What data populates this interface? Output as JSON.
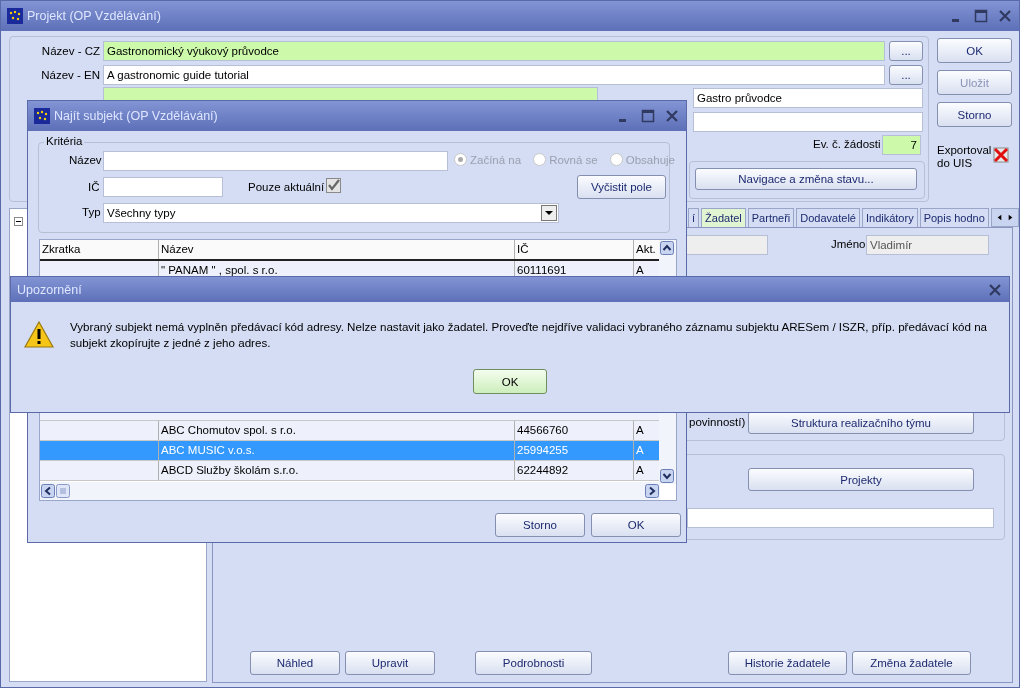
{
  "main_window": {
    "title": "Projekt  (OP Vzdělávání)",
    "name_fields": [
      {
        "label": "Název - CZ",
        "value": "Gastronomický výukový průvodce",
        "required": true,
        "button": "..."
      },
      {
        "label": "Název - EN",
        "value": "A gastronomic guide tutorial",
        "required": false,
        "button": "..."
      }
    ],
    "reg_number": {
      "required": true
    },
    "short_name_cz": {
      "value": "Gastro průvodce"
    },
    "application_number": {
      "label": "Ev. č. žádosti",
      "value": "7",
      "required": true
    },
    "navigation_button": "Navigace a změna stavu...",
    "side_buttons": [
      {
        "label": "OK",
        "disabled": false
      },
      {
        "label": "Uložit",
        "disabled": true
      },
      {
        "label": "Storno",
        "disabled": false
      }
    ],
    "exported": {
      "label": "Exportoval do UIS",
      "checked": false
    },
    "tabs": [
      {
        "label": "í",
        "selected": false
      },
      {
        "label": "Žadatel",
        "selected": true
      },
      {
        "label": "Partneři",
        "selected": false
      },
      {
        "label": "Dodavatelé",
        "selected": false
      },
      {
        "label": "Indikátory",
        "selected": false
      },
      {
        "label": "Popis hodno",
        "selected": false
      }
    ],
    "applicant": {
      "name_label": "Jméno",
      "name_value": "Vladimír",
      "obligations_text": "povinností)",
      "team_button": "Struktura realizačního týmu",
      "projects_button": "Projekty"
    },
    "bottom_buttons": [
      "Náhled",
      "Upravit",
      "Podrobnosti",
      "Historie žadatele",
      "Změna žadatele"
    ]
  },
  "find_dialog": {
    "title": "Najít subjekt  (OP Vzdělávání)",
    "criteria_title": "Kritéria",
    "name_label": "Název",
    "match_options": [
      {
        "label": "Začíná na",
        "selected": true
      },
      {
        "label": "Rovná se",
        "selected": false
      },
      {
        "label": "Obsahuje",
        "selected": false
      }
    ],
    "id_label": "IČ",
    "current_only": {
      "label": "Pouze aktuální",
      "checked": true
    },
    "clear_button": "Vyčistit pole",
    "type_label": "Typ",
    "type_value": "Všechny typy",
    "table": {
      "columns": [
        "Zkratka",
        "Název",
        "IČ",
        "Akt."
      ],
      "top_rows": [
        {
          "cells": [
            "",
            "\" PANAM \" , spol. s r.o.",
            "60111691",
            "A"
          ],
          "selected": false
        }
      ],
      "bottom_rows": [
        {
          "cells": [
            "",
            "ABC Chomutov spol. s r.o.",
            "44566760",
            "A"
          ],
          "selected": false
        },
        {
          "cells": [
            "",
            "ABC MUSIC v.o.s.",
            "25994255",
            "A"
          ],
          "selected": true
        },
        {
          "cells": [
            "",
            "ABCD Služby školám  s.r.o.",
            "62244892",
            "A"
          ],
          "selected": false
        }
      ]
    },
    "buttons": [
      "Storno",
      "OK"
    ]
  },
  "alert": {
    "title": "Upozornění",
    "message": "Vybraný subjekt nemá vyplněn předávací kód adresy. Nelze nastavit jako žadatel. Proveďte nejdříve validaci vybraného záznamu subjektu ARESem / ISZR, příp. předávací kód na subjekt zkopírujte z jedné z jeho adres.",
    "button": "OK"
  }
}
